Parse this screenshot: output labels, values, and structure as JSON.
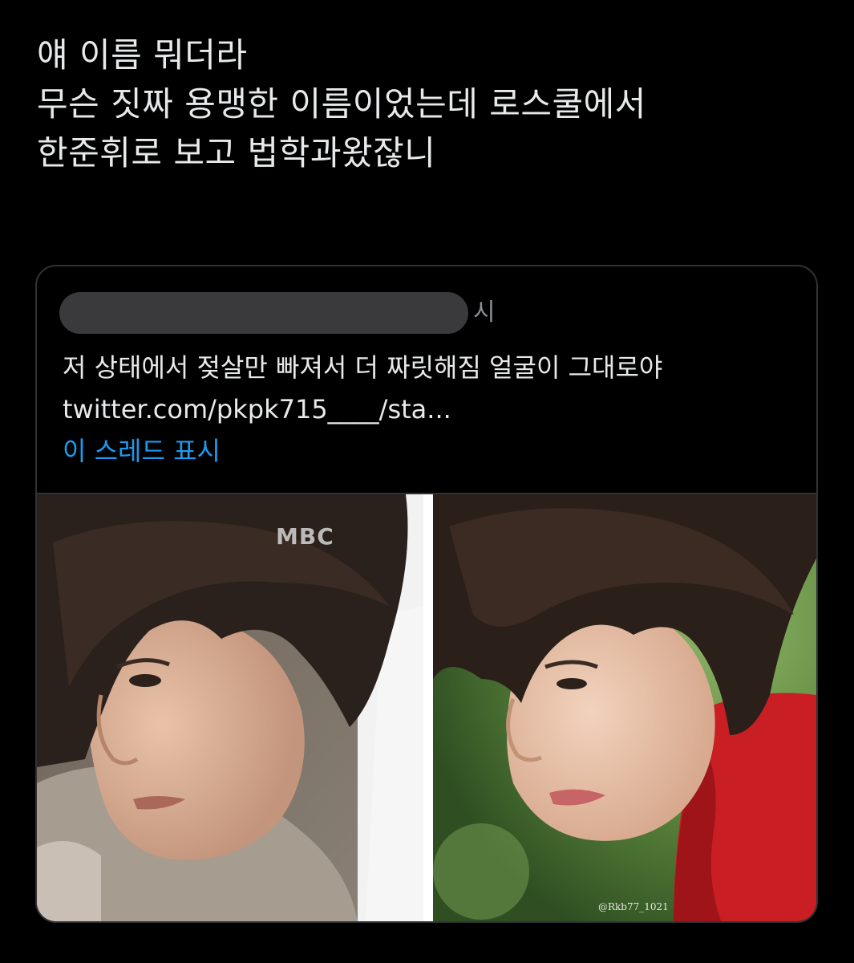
{
  "tweet": {
    "lines": [
      "얘 이름 뭐더라",
      "무슨 짓짜 용맹한 이름이었는데 로스쿨에서",
      "한준휘로 보고 법학과왔잖니"
    ]
  },
  "quoted_tweet": {
    "author_trailing": "시",
    "text_lines": [
      "저 상태에서 젖살만 빠져서 더 짜릿해짐 얼굴이 그대로야",
      "twitter.com/pkpk715____/sta..."
    ],
    "show_thread_label": "이 스레드 표시",
    "media": {
      "left_watermark": "MBC",
      "right_watermark": "@Rkb77_1021"
    }
  },
  "colors": {
    "background": "#000000",
    "text": "#e7e9ea",
    "link": "#1d9bf0",
    "border": "#2f3336",
    "redaction": "#3a3a3c"
  }
}
